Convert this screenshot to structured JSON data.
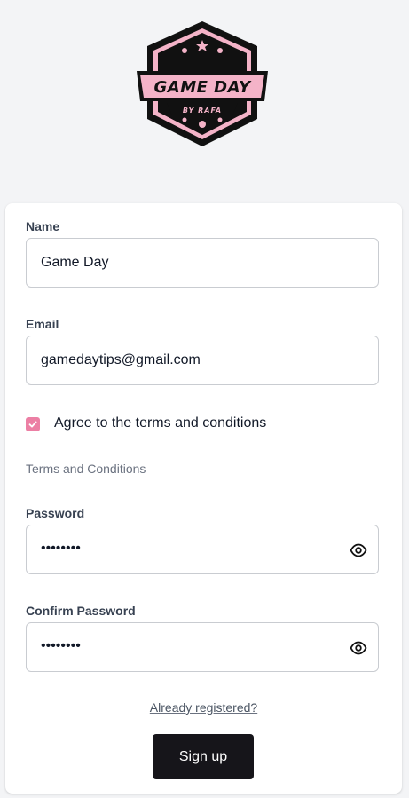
{
  "logo": {
    "title": "GAME DAY",
    "subtitle": "BY RAFA"
  },
  "form": {
    "name_label": "Name",
    "name_value": "Game Day",
    "email_label": "Email",
    "email_value": "gamedaytips@gmail.com",
    "agree_label": "Agree to the terms and conditions",
    "agree_checked": true,
    "terms_link": "Terms and Conditions",
    "password_label": "Password",
    "password_value": "••••••••",
    "confirm_password_label": "Confirm Password",
    "confirm_password_value": "••••••••",
    "already_registered": "Already registered?",
    "signup_label": "Sign up"
  },
  "icons": {
    "password_toggle": "eye-icon",
    "confirm_password_toggle": "eye-icon",
    "checkbox": "check-icon"
  },
  "colors": {
    "accent_pink": "#ec7fa4",
    "logo_pink": "#f4b3c8",
    "button_dark": "#16151a",
    "page_bg": "#f3f4f6"
  }
}
